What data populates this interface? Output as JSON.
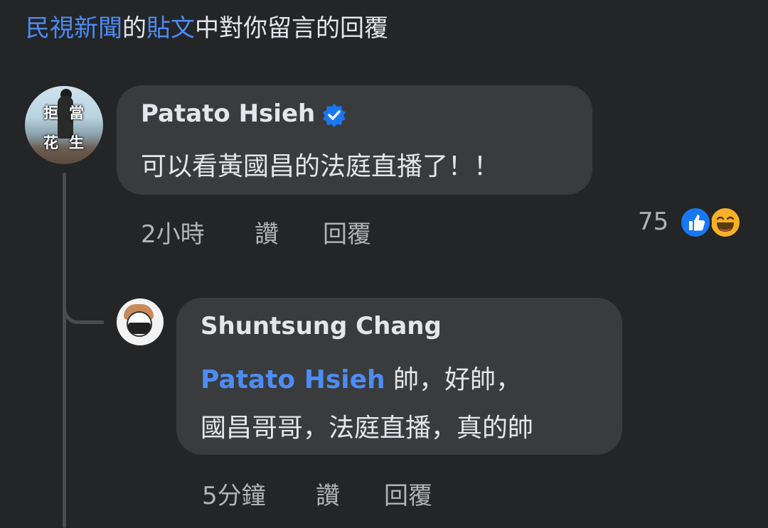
{
  "header": {
    "page_name": "民視新聞",
    "connector": "的",
    "post_word": "貼文",
    "suffix": "中對你留言的回覆"
  },
  "comment": {
    "author": "Patato Hsieh",
    "avatar_text": [
      "拒",
      "當",
      "花",
      "生"
    ],
    "text": "可以看黃國昌的法庭直播了！！",
    "time": "2小時",
    "like_label": "讚",
    "reply_label": "回覆",
    "reaction_count": "75",
    "reaction_icons": [
      "like-icon",
      "haha-icon"
    ]
  },
  "reply": {
    "author": "Shuntsung Chang",
    "mention": "Patato Hsieh",
    "line1": " 帥，好帥，",
    "line2": "國昌哥哥，法庭直播，真的帥",
    "time": "5分鐘",
    "like_label": "讚",
    "reply_label": "回覆"
  },
  "colors": {
    "background": "#242526",
    "bubble": "#3a3b3c",
    "link": "#4d8cf5",
    "text": "#e4e6eb",
    "secondary": "#b0b3b8"
  }
}
